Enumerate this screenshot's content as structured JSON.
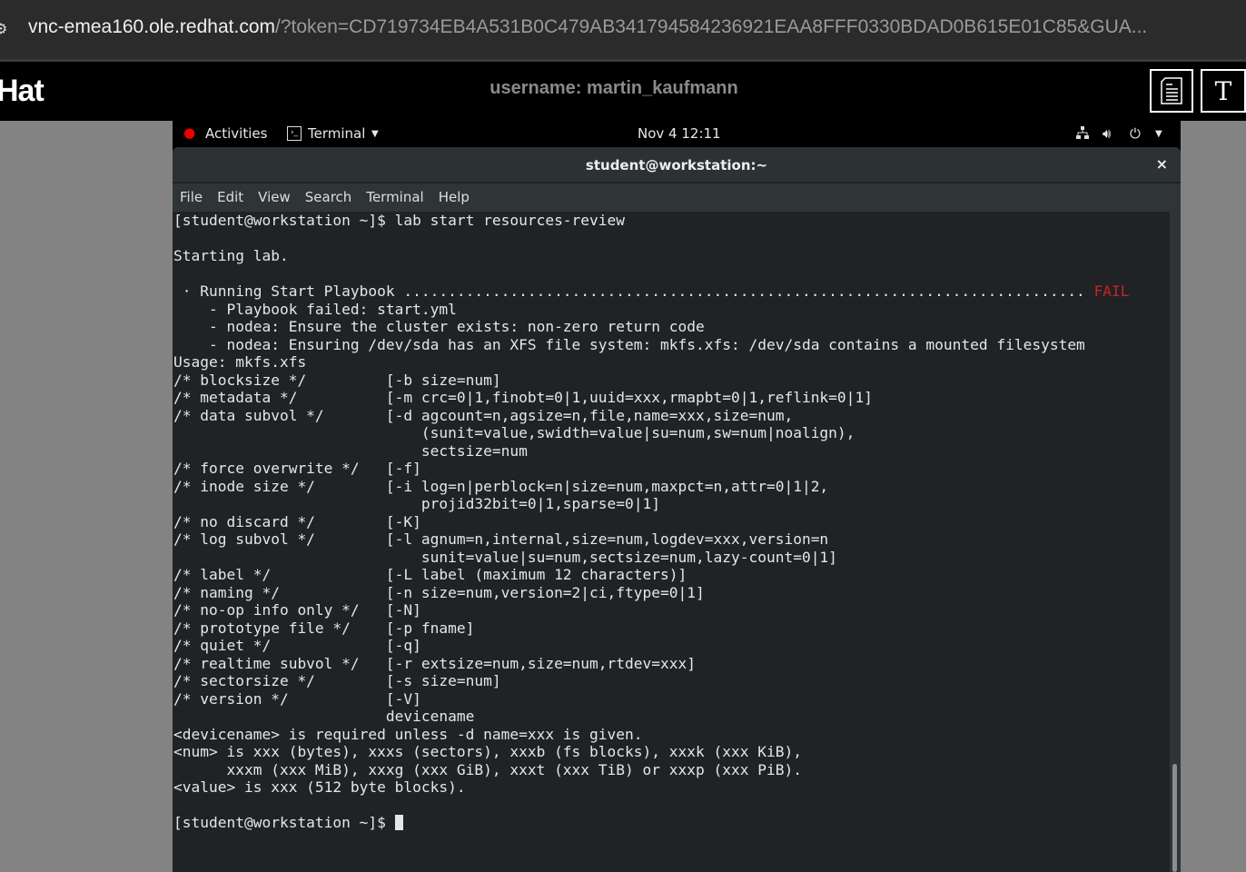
{
  "browser": {
    "url_host": "vnc-emea160.ole.redhat.com",
    "url_rest": "/?token=CD719734EB4A531B0C479AB341794584236921EAA8FFF0330BDAD0B615E01C85&GUA..."
  },
  "header": {
    "logo": "Hat",
    "username": "username: martin_kaufmann",
    "notes_icon": "document-icon",
    "font_button": "T"
  },
  "topbar": {
    "activities": "Activities",
    "app": "Terminal",
    "clock": "Nov 4  12:11"
  },
  "window": {
    "title": "student@workstation:~",
    "close": "×"
  },
  "menu": [
    "File",
    "Edit",
    "View",
    "Search",
    "Terminal",
    "Help"
  ],
  "terminal": {
    "lines": [
      "[student@workstation ~]$ lab start resources-review",
      "",
      "Starting lab.",
      "",
      " · Running Start Playbook ............................................................................. ",
      "    - Playbook failed: start.yml",
      "    - nodea: Ensure the cluster exists: non-zero return code",
      "    - nodea: Ensuring /dev/sda has an XFS file system: mkfs.xfs: /dev/sda contains a mounted filesystem",
      "Usage: mkfs.xfs",
      "/* blocksize */         [-b size=num]",
      "/* metadata */          [-m crc=0|1,finobt=0|1,uuid=xxx,rmapbt=0|1,reflink=0|1]",
      "/* data subvol */       [-d agcount=n,agsize=n,file,name=xxx,size=num,",
      "                            (sunit=value,swidth=value|su=num,sw=num|noalign),",
      "                            sectsize=num",
      "/* force overwrite */   [-f]",
      "/* inode size */        [-i log=n|perblock=n|size=num,maxpct=n,attr=0|1|2,",
      "                            projid32bit=0|1,sparse=0|1]",
      "/* no discard */        [-K]",
      "/* log subvol */        [-l agnum=n,internal,size=num,logdev=xxx,version=n",
      "                            sunit=value|su=num,sectsize=num,lazy-count=0|1]",
      "/* label */             [-L label (maximum 12 characters)]",
      "/* naming */            [-n size=num,version=2|ci,ftype=0|1]",
      "/* no-op info only */   [-N]",
      "/* prototype file */    [-p fname]",
      "/* quiet */             [-q]",
      "/* realtime subvol */   [-r extsize=num,size=num,rtdev=xxx]",
      "/* sectorsize */        [-s size=num]",
      "/* version */           [-V]",
      "                        devicename",
      "<devicename> is required unless -d name=xxx is given.",
      "<num> is xxx (bytes), xxxs (sectors), xxxb (fs blocks), xxxk (xxx KiB),",
      "      xxxm (xxx MiB), xxxg (xxx GiB), xxxt (xxx TiB) or xxxp (xxx PiB).",
      "<value> is xxx (512 byte blocks).",
      "",
      "[student@workstation ~]$ "
    ],
    "fail_label": "FAIL",
    "fail_line": 4,
    "colors": {
      "fail": "#d02020",
      "bg": "#1f2326",
      "fg": "#e6e6e6"
    }
  }
}
